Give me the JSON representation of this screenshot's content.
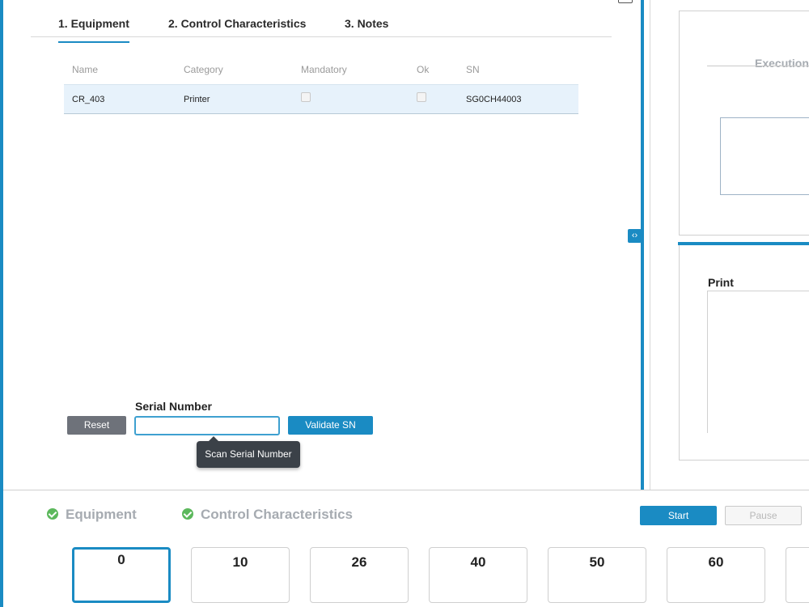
{
  "tabs": [
    {
      "label": "1. Equipment",
      "active": true
    },
    {
      "label": "2. Control Characteristics",
      "active": false
    },
    {
      "label": "3. Notes",
      "active": false
    }
  ],
  "table": {
    "columns": [
      "Name",
      "Category",
      "Mandatory",
      "Ok",
      "SN"
    ],
    "rows": [
      {
        "name": "CR_403",
        "category": "Printer",
        "mandatory": false,
        "ok": false,
        "sn": "SG0CH44003"
      }
    ]
  },
  "serial": {
    "label": "Serial Number",
    "value": "",
    "placeholder": "",
    "reset_label": "Reset",
    "validate_label": "Validate SN",
    "tooltip": "Scan Serial Number"
  },
  "right_panel": {
    "execution_title": "Execution",
    "print_title": "Print",
    "splitter_glyph": "‹›"
  },
  "bottom": {
    "statuses": [
      {
        "label": "Equipment",
        "done": true
      },
      {
        "label": "Control Characteristics",
        "done": true
      }
    ],
    "start_label": "Start",
    "pause_label": "Pause",
    "steps": [
      "0",
      "10",
      "26",
      "40",
      "50",
      "60",
      ""
    ]
  },
  "colors": {
    "accent": "#1a8bc3",
    "success": "#5cb85c",
    "muted": "#a6abb1",
    "row_highlight": "#e7f2fb"
  }
}
